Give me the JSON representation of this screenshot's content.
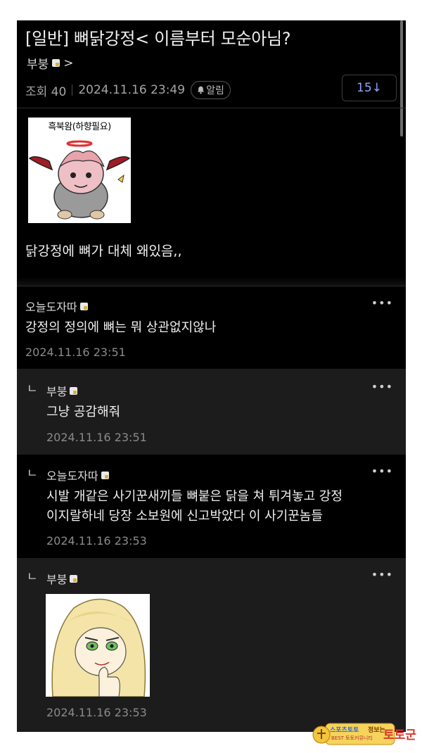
{
  "post": {
    "title": "[일반] 뼈닭강정< 이름부터 모순아님?",
    "author": "부붕",
    "author_chevron": ">",
    "views_label": "조회 40",
    "date": "2024.11.16 23:49",
    "alarm_label": "알림",
    "comment_count": "15↓",
    "image_caption": "흑북왐(하향필요)",
    "body": "닭강정에 뼈가 대체 왜있음,,"
  },
  "comments": [
    {
      "author": "오늘도자따",
      "text": "강정의 정의에 뼈는 뭐 상관없지않나",
      "date": "2024.11.16 23:51",
      "reply": false
    },
    {
      "author": "부붕",
      "text": "그냥 공감해줘",
      "date": "2024.11.16 23:51",
      "reply": true
    },
    {
      "author": "오늘도자따",
      "text_lines": [
        "시발 개같은 사기꾼새끼들 뼈붙은 닭을 쳐 튀겨놓고 강정",
        "이지랄하네 당장 소보원에 신고박았다 이 사기꾼놈들"
      ],
      "date": "2024.11.16 23:53",
      "reply": true
    },
    {
      "author": "부붕",
      "date": "2024.11.16 23:53",
      "reply": true
    }
  ],
  "more_label": "•••",
  "reply_icon": "ㄴ",
  "watermark": {
    "line1": "스포츠토토",
    "line2": "정보는",
    "brand": "토토군",
    "sub": "BEST 토토커뮤니티"
  },
  "colors": {
    "background": "#000000",
    "reply_bg": "#1c1c1c",
    "count_blue": "#8fa4ff"
  }
}
